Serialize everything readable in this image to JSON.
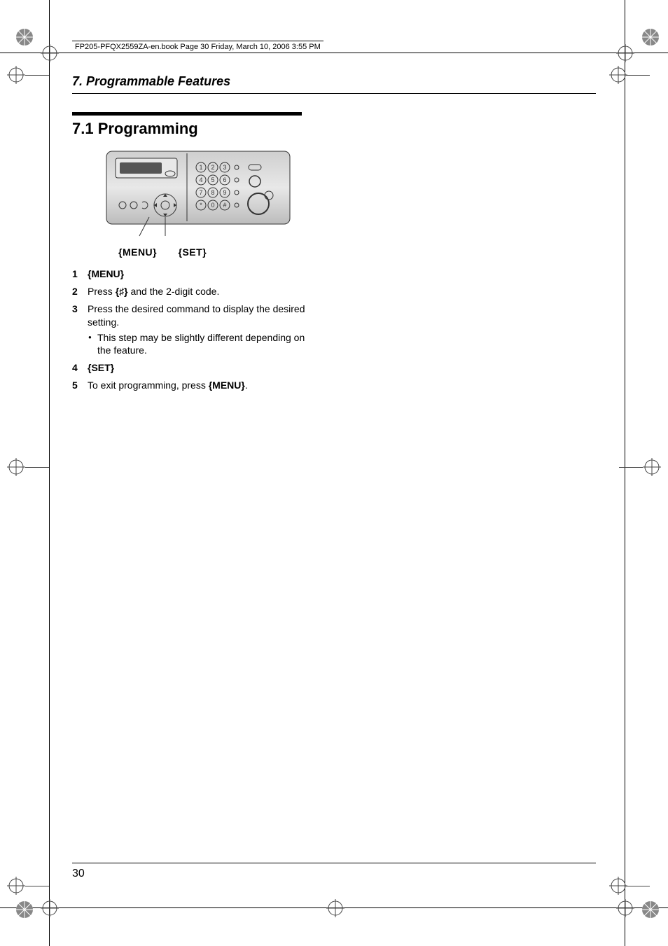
{
  "header_pageref": "FP205-PFQX2559ZA-en.book  Page 30  Friday, March 10, 2006  3:55 PM",
  "chapter_title": "7. Programmable Features",
  "section_title": "7.1 Programming",
  "keypad_labels": {
    "menu": "{MENU}",
    "set": "{SET}"
  },
  "steps": {
    "s1": "{MENU}",
    "s2_pre": "Press ",
    "s2_key": "{♯}",
    "s2_post": " and the 2-digit code.",
    "s3": "Press the desired command to display the desired setting.",
    "s3_bullet": "This step may be slightly different depending on the feature.",
    "s4": "{SET}",
    "s5_pre": "To exit programming, press ",
    "s5_key": "{MENU}",
    "s5_post": "."
  },
  "page_number": "30",
  "keypad_keys": [
    "1",
    "2",
    "3",
    "4",
    "5",
    "6",
    "7",
    "8",
    "9",
    "*",
    "0",
    "#"
  ]
}
